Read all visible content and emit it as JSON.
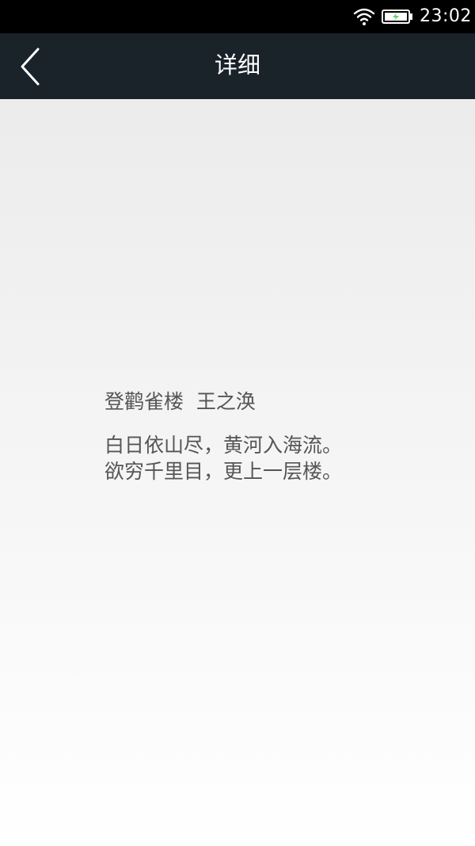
{
  "status_bar": {
    "time": "23:02",
    "icons": [
      "wifi-icon",
      "battery-charging-icon"
    ],
    "battery_color": "#5fd05f"
  },
  "header": {
    "title": "详细",
    "back_icon": "chevron-left-icon",
    "background": "#1a222a"
  },
  "poem": {
    "title_line": "登鹳雀楼  王之涣",
    "lines": [
      "白日依山尽，黄河入海流。",
      "欲穷千里目，更上一层楼。"
    ]
  }
}
